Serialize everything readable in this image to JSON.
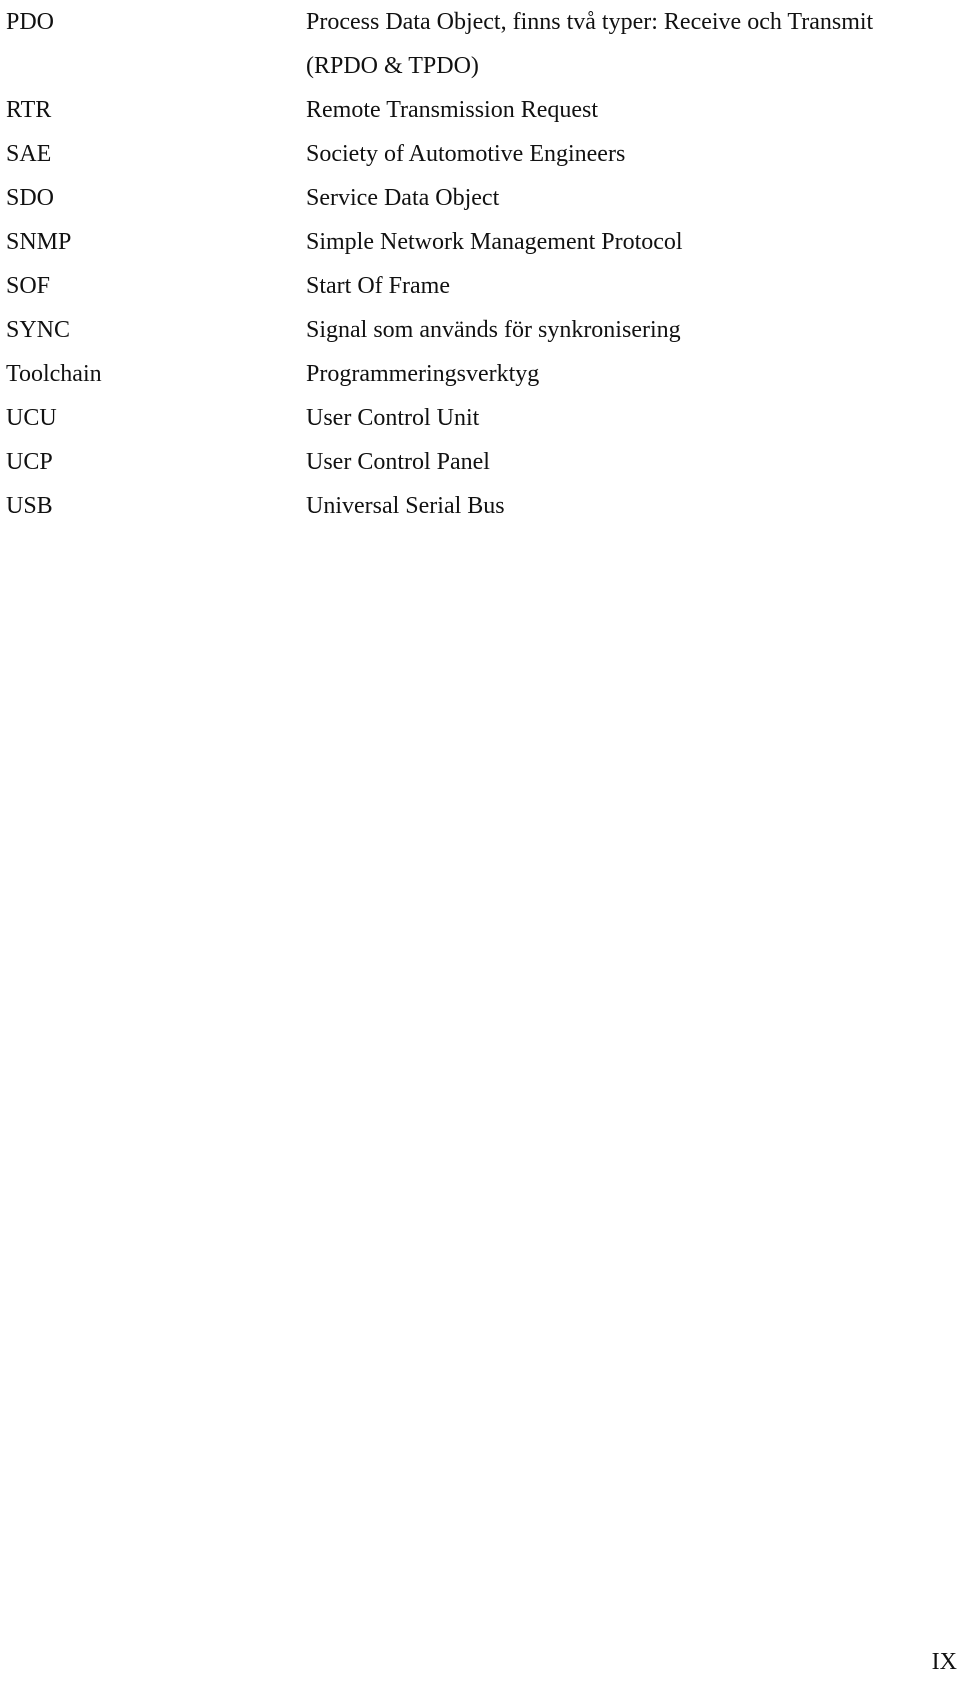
{
  "abbreviations": [
    {
      "term": "PDO",
      "definition_lines": [
        "Process Data Object, finns två typer: Receive och Transmit",
        "(RPDO & TPDO)"
      ]
    },
    {
      "term": "RTR",
      "definition_lines": [
        "Remote Transmission Request"
      ]
    },
    {
      "term": "SAE",
      "definition_lines": [
        "Society of Automotive Engineers"
      ]
    },
    {
      "term": "SDO",
      "definition_lines": [
        "Service Data Object"
      ]
    },
    {
      "term": "SNMP",
      "definition_lines": [
        "Simple Network Management Protocol"
      ]
    },
    {
      "term": "SOF",
      "definition_lines": [
        "Start Of Frame"
      ]
    },
    {
      "term": "SYNC",
      "definition_lines": [
        "Signal som används för synkronisering"
      ]
    },
    {
      "term": "Toolchain",
      "definition_lines": [
        "Programmeringsverktyg"
      ]
    },
    {
      "term": "UCU",
      "definition_lines": [
        "User Control Unit"
      ]
    },
    {
      "term": "UCP",
      "definition_lines": [
        "User Control Panel"
      ]
    },
    {
      "term": "USB",
      "definition_lines": [
        "Universal Serial Bus"
      ]
    }
  ],
  "page_number": "IX"
}
